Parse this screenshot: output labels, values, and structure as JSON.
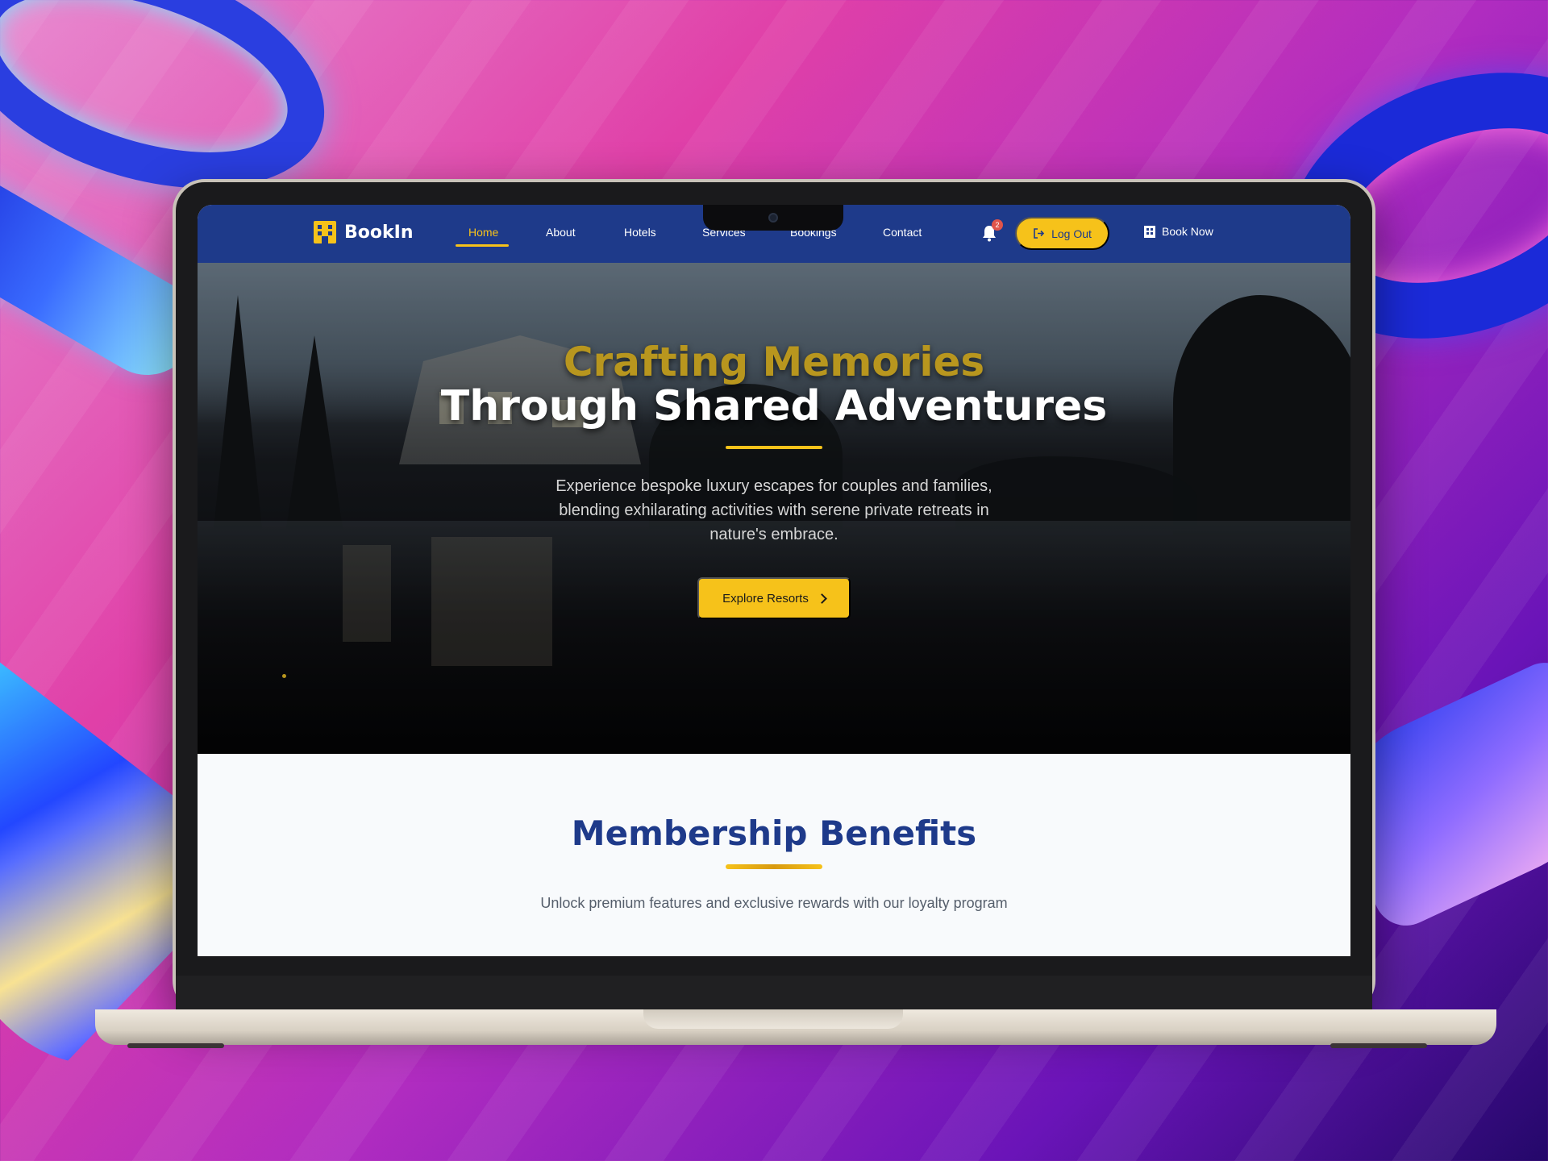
{
  "brand": {
    "name": "BookIn",
    "icon": "hotel-building-icon",
    "accent": "#f6c21a",
    "nav_bg": "#1e3a8a"
  },
  "nav": {
    "items": [
      {
        "label": "Home",
        "active": true
      },
      {
        "label": "About"
      },
      {
        "label": "Hotels"
      },
      {
        "label": "Services"
      },
      {
        "label": "Bookings"
      },
      {
        "label": "Contact"
      }
    ],
    "notification_count": "2",
    "logout_label": "Log Out",
    "book_now_label": "Book Now"
  },
  "hero": {
    "title_line1": "Crafting Memories",
    "title_line2": "Through Shared Adventures",
    "description": "Experience bespoke luxury escapes for couples and families, blending exhilarating activities with serene private retreats in nature's embrace.",
    "cta_label": "Explore Resorts"
  },
  "membership": {
    "title": "Membership Benefits",
    "subtitle": "Unlock premium features and exclusive rewards with our loyalty program"
  }
}
